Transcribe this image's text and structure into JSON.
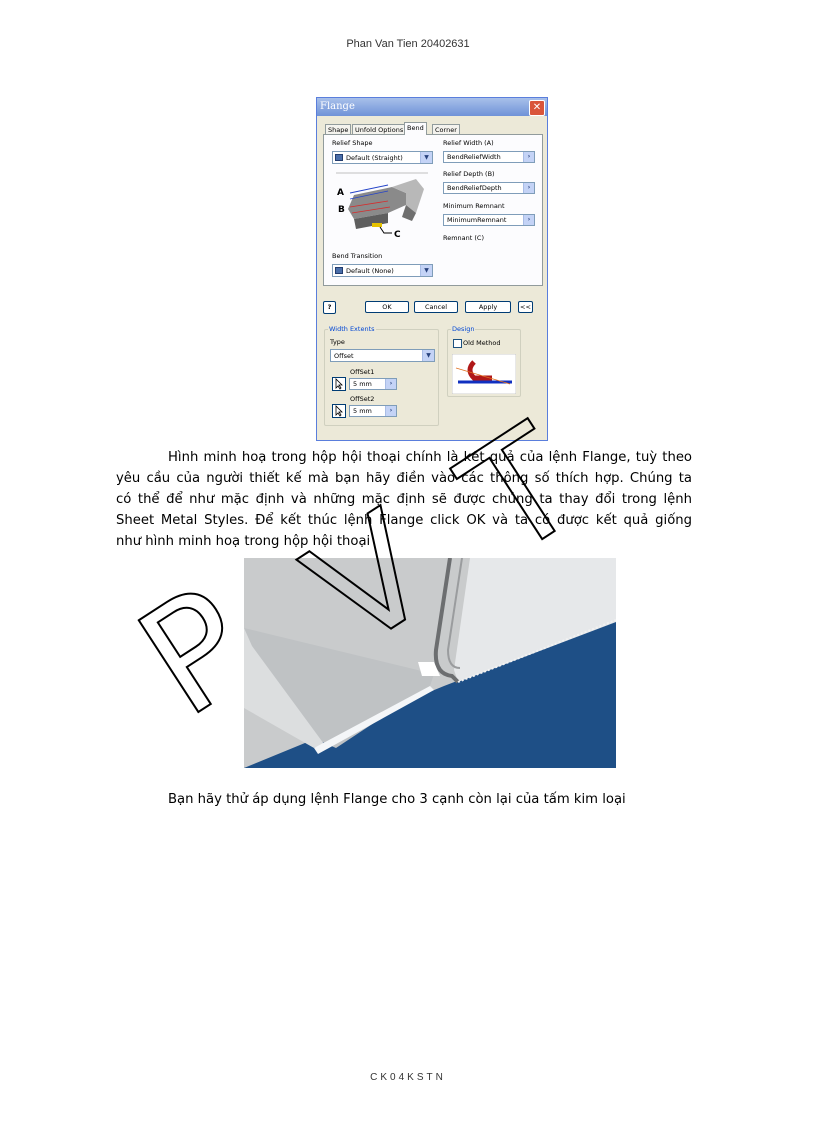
{
  "header": {
    "author": "Phan Van Tien 20402631"
  },
  "dialog": {
    "title": "Flange",
    "close_glyph": "✕",
    "tabs": [
      {
        "label": "Shape"
      },
      {
        "label": "Unfold Options"
      },
      {
        "label": "Bend",
        "active": true
      },
      {
        "label": "Corner"
      }
    ],
    "relief_shape": {
      "label": "Relief Shape",
      "value": "Default (Straight)"
    },
    "relief_width": {
      "label": "Relief Width (A)",
      "value": "BendReliefWidth"
    },
    "relief_depth": {
      "label": "Relief Depth (B)",
      "value": "BendReliefDepth"
    },
    "minimum_remnant": {
      "label": "Minimum Remnant",
      "value": "MinimumRemnant"
    },
    "remnant_label": "Remnant (C)",
    "diagram_letters": [
      "A",
      "B",
      "C"
    ],
    "bend_transition": {
      "label": "Bend Transition",
      "value": "Default (None)"
    },
    "buttons": {
      "help": "?",
      "ok": "OK",
      "cancel": "Cancel",
      "apply": "Apply",
      "collapse": "<<"
    },
    "width_extents": {
      "group_label": "Width Extents",
      "type_label": "Type",
      "type_value": "Offset",
      "offset1_label": "OffSet1",
      "offset1_value": "5 mm",
      "offset2_label": "OffSet2",
      "offset2_value": "5 mm"
    },
    "design": {
      "group_label": "Design",
      "old_method_label": "Old Method",
      "old_method_checked": false
    }
  },
  "body": {
    "paragraph_lines": [
      "Hình minh hoạ trong hộp hội thoại chính là kết quả của lệnh Flange, tuỳ theo",
      "yêu cầu của người thiết kế mà bạn hãy điền vào các thông số thích hợp. Chúng ta",
      "có thể để như mặc định và những mặc định sẽ được chúng ta thay đổi trong lệnh",
      "Sheet Metal Styles. Để kết thúc lệnh Flange click OK và ta có được kết quả giống",
      "như hình minh hoạ trong hộp hội thoại"
    ],
    "caption": "Bạn hãy thử áp dụng lệnh Flange cho 3 cạnh còn lại của tấm kim loại"
  },
  "watermark": {
    "letters": [
      "P",
      "V",
      "T"
    ],
    "color": "#000000"
  },
  "footer": {
    "text": "CK04KSTN"
  },
  "colors": {
    "titlebar": "#6f92d8",
    "close": "#d9553a",
    "group_label": "#0046d5",
    "photo_blue": "#1e4f86"
  }
}
